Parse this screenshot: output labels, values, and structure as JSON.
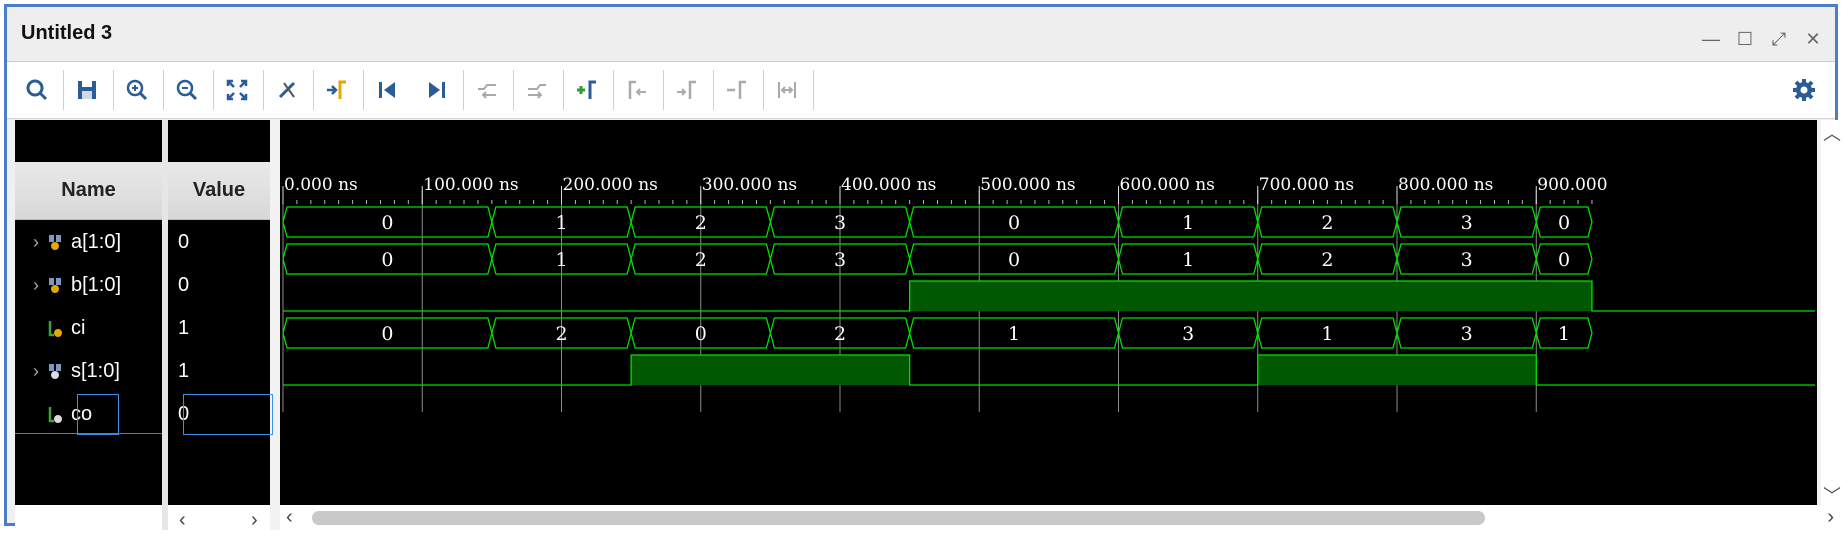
{
  "window": {
    "title": "Untitled 3"
  },
  "toolbar": {
    "icons": [
      "search-icon",
      "save-icon",
      "zoom-in-icon",
      "zoom-out-icon",
      "zoom-fit-icon",
      "snap-cursor-icon",
      "go-to-cursor-icon",
      "go-to-time-zero-icon",
      "go-to-last-time-icon",
      "previous-transition-icon",
      "next-transition-icon",
      "add-marker-icon",
      "previous-marker-icon",
      "next-marker-icon",
      "swap-cursors-icon",
      "fix-cursor-icon",
      "settings-icon"
    ]
  },
  "columns": {
    "name": "Name",
    "value": "Value"
  },
  "signals": [
    {
      "name": "a[1:0]",
      "value": "0",
      "kind": "bus",
      "expandable": true,
      "segments": [
        "0",
        "1",
        "2",
        "3",
        "0",
        "1",
        "2",
        "3",
        "0"
      ]
    },
    {
      "name": "b[1:0]",
      "value": "0",
      "kind": "bus",
      "expandable": true,
      "segments": [
        "0",
        "1",
        "2",
        "3",
        "0",
        "1",
        "2",
        "3",
        "0"
      ]
    },
    {
      "name": "ci",
      "value": "1",
      "kind": "bit",
      "expandable": false
    },
    {
      "name": "s[1:0]",
      "value": "1",
      "kind": "bus",
      "expandable": true,
      "segments": [
        "0",
        "2",
        "0",
        "2",
        "1",
        "3",
        "1",
        "3",
        "1"
      ]
    },
    {
      "name": "co",
      "value": "0",
      "kind": "bit",
      "expandable": false
    }
  ],
  "timeline": {
    "unit": "ns",
    "ticks": [
      "0.000 ns",
      "100.000 ns",
      "200.000 ns",
      "300.000 ns",
      "400.000 ns",
      "500.000 ns",
      "600.000 ns",
      "700.000 ns",
      "800.000 ns",
      "900.000"
    ],
    "tick_values": [
      0,
      100,
      200,
      300,
      400,
      500,
      600,
      700,
      800,
      900
    ],
    "view_range": [
      0,
      940
    ],
    "bus_transitions": [
      150,
      250,
      350,
      450,
      600,
      700,
      800,
      900
    ],
    "ci_high": [
      [
        450,
        940
      ]
    ],
    "co_high": [
      [
        250,
        450
      ],
      [
        700,
        900
      ]
    ]
  },
  "colors": {
    "wave": "#00e000",
    "fill": "#005800",
    "background": "#000000",
    "grid": "#8a8a8a",
    "accent": "#3b8fe8"
  }
}
